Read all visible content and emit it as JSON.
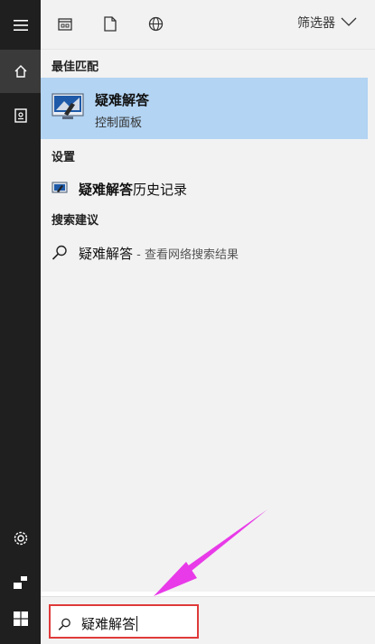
{
  "toolbar": {
    "filter_label": "筛选器",
    "icons": [
      "apps-icon",
      "document-icon",
      "web-icon",
      "chevron-down-icon"
    ]
  },
  "rail": {
    "icons": [
      "hamburger-menu-icon",
      "home-icon",
      "device-icon",
      "settings-icon",
      "user-icon",
      "windows-start-icon"
    ]
  },
  "sections": {
    "best_match": "最佳匹配",
    "settings": "设置",
    "search_suggestions": "搜索建议"
  },
  "best_match_item": {
    "title": "疑难解答",
    "subtitle": "控制面板"
  },
  "settings_item": {
    "bold": "疑难解答",
    "rest": "历史记录"
  },
  "suggestion_item": {
    "bold": "疑难解答",
    "rest": " - 查看网络搜索结果"
  },
  "search": {
    "value": "疑难解答"
  },
  "colors": {
    "rail_bg": "#1f1f1f",
    "panel_bg": "#f2f2f2",
    "selected_bg": "#b3d4f3",
    "search_border": "#e03a3a",
    "arrow": "#e83ae8"
  }
}
